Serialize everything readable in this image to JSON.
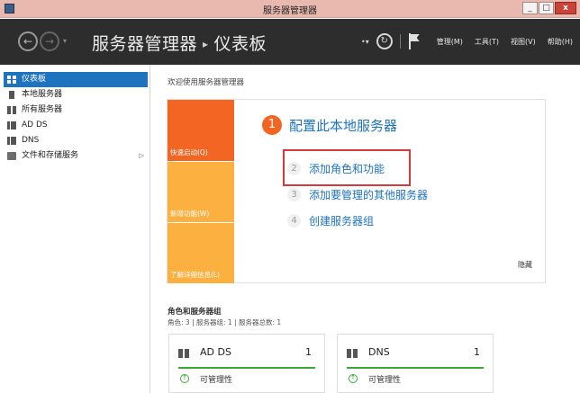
{
  "window": {
    "title": "服务器管理器",
    "buttons": {
      "minimize": "_",
      "maximize": "□",
      "close": "x"
    },
    "accent_color": "#e9b9b0"
  },
  "header": {
    "breadcrumb_root": "服务器管理器",
    "breadcrumb_separator": "▸",
    "breadcrumb_current": "仪表板",
    "menu": [
      "管理(M)",
      "工具(T)",
      "视图(V)",
      "帮助(H)"
    ],
    "background_color": "#2d2d2d"
  },
  "sidebar": {
    "items": [
      {
        "label": "仪表板",
        "icon": "dashboard-icon",
        "active": true
      },
      {
        "label": "本地服务器",
        "icon": "server-icon"
      },
      {
        "label": "所有服务器",
        "icon": "servers-icon"
      },
      {
        "label": "AD DS",
        "icon": "role-icon"
      },
      {
        "label": "DNS",
        "icon": "role-icon"
      },
      {
        "label": "文件和存储服务",
        "icon": "folder-icon",
        "has_submenu": true
      }
    ],
    "active_color": "#1e73be"
  },
  "main": {
    "welcome": "欢迎使用服务器管理器",
    "tiles": [
      "快速启动(Q)",
      "新增功能(W)",
      "了解详细信息(L)"
    ],
    "steps": [
      {
        "num": "1",
        "label": "配置此本地服务器"
      },
      {
        "num": "2",
        "label": "添加角色和功能"
      },
      {
        "num": "3",
        "label": "添加要管理的其他服务器"
      },
      {
        "num": "4",
        "label": "创建服务器组"
      }
    ],
    "hide_link": "隐藏",
    "roles_title": "角色和服务器组",
    "roles_summary": "角色: 3 | 服务器组: 1 | 服务器总数: 1",
    "cards": [
      {
        "title": "AD DS",
        "count": "1",
        "status": "可管理性"
      },
      {
        "title": "DNS",
        "count": "1",
        "status": "可管理性"
      }
    ]
  }
}
